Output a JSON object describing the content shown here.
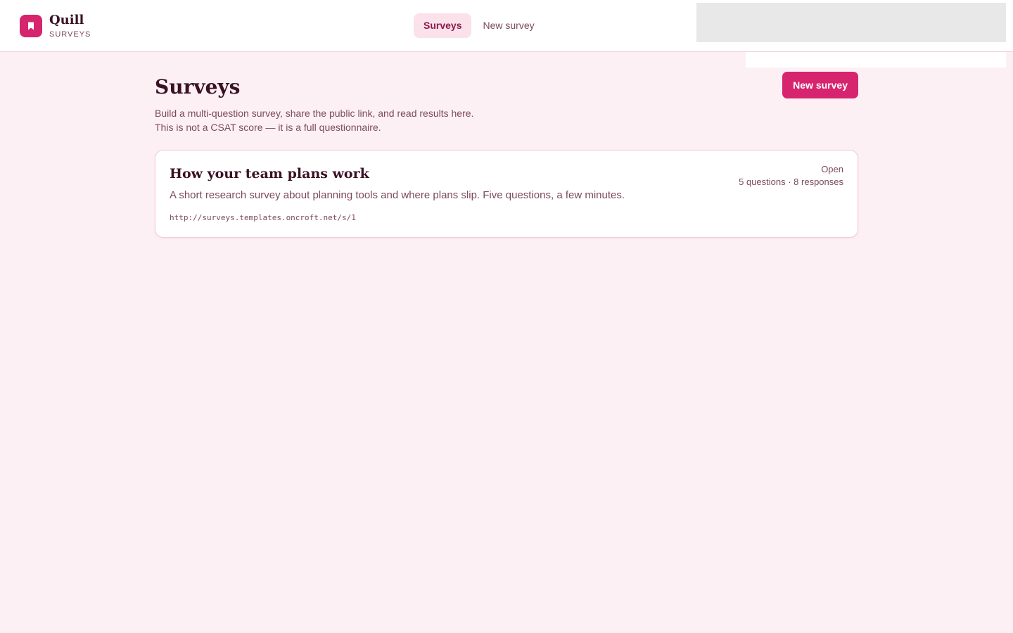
{
  "app": {
    "name": "Quill",
    "subtitle": "SURVEYS",
    "logo_icon": "bookmark-icon",
    "accent_color": "#d6246e"
  },
  "nav": {
    "items": [
      {
        "label": "Surveys",
        "active": true
      },
      {
        "label": "New survey",
        "active": false
      }
    ]
  },
  "page": {
    "title": "Surveys",
    "description_line1": "Build a multi-question survey, share the public link, and read results here.",
    "description_line2": "This is not a CSAT score — it is a full questionnaire.",
    "new_survey_label": "New survey"
  },
  "surveys": [
    {
      "title": "How your team plans work",
      "description": "A short research survey about planning tools and where plans slip. Five questions, a few minutes.",
      "url": "http://surveys.templates.oncroft.net/s/1",
      "status": "Open",
      "meta": "5 questions · 8 responses"
    }
  ]
}
